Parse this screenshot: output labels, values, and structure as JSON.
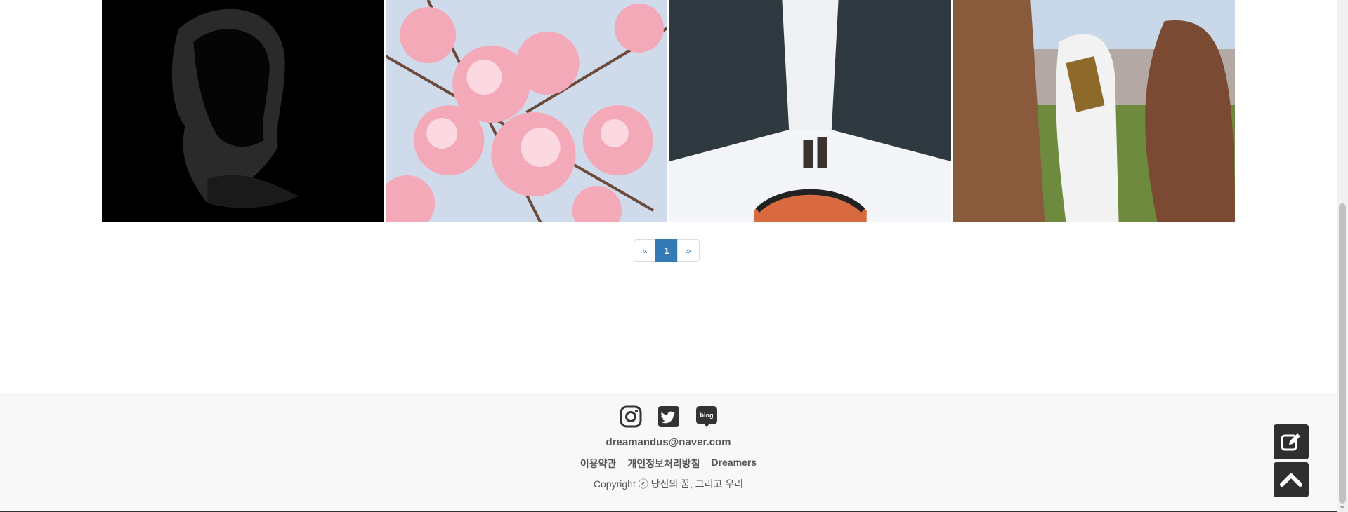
{
  "gallery": {
    "images": [
      {
        "icon": "hooded-figure-photo"
      },
      {
        "icon": "cherry-blossom-photo"
      },
      {
        "icon": "dog-sled-snow-forest-photo"
      },
      {
        "icon": "oil-wrestling-photo"
      }
    ]
  },
  "pagination": {
    "prev": "«",
    "pages": [
      "1"
    ],
    "current": "1",
    "next": "»"
  },
  "footer": {
    "social": [
      "instagram-icon",
      "twitter-icon",
      "blog-icon"
    ],
    "blog_text": "blog",
    "email": "dreamandus@naver.com",
    "links": [
      "이용약관",
      "개인정보처리방침",
      "Dreamers"
    ],
    "copyright": "Copyright ⓒ 당신의 꿈, 그리고 우리"
  },
  "floating": [
    "write-icon",
    "scroll-top-icon"
  ],
  "colors": {
    "accent": "#337ab7",
    "footer_bg": "#f8f8f8",
    "float_btn": "#2f2f2f"
  }
}
